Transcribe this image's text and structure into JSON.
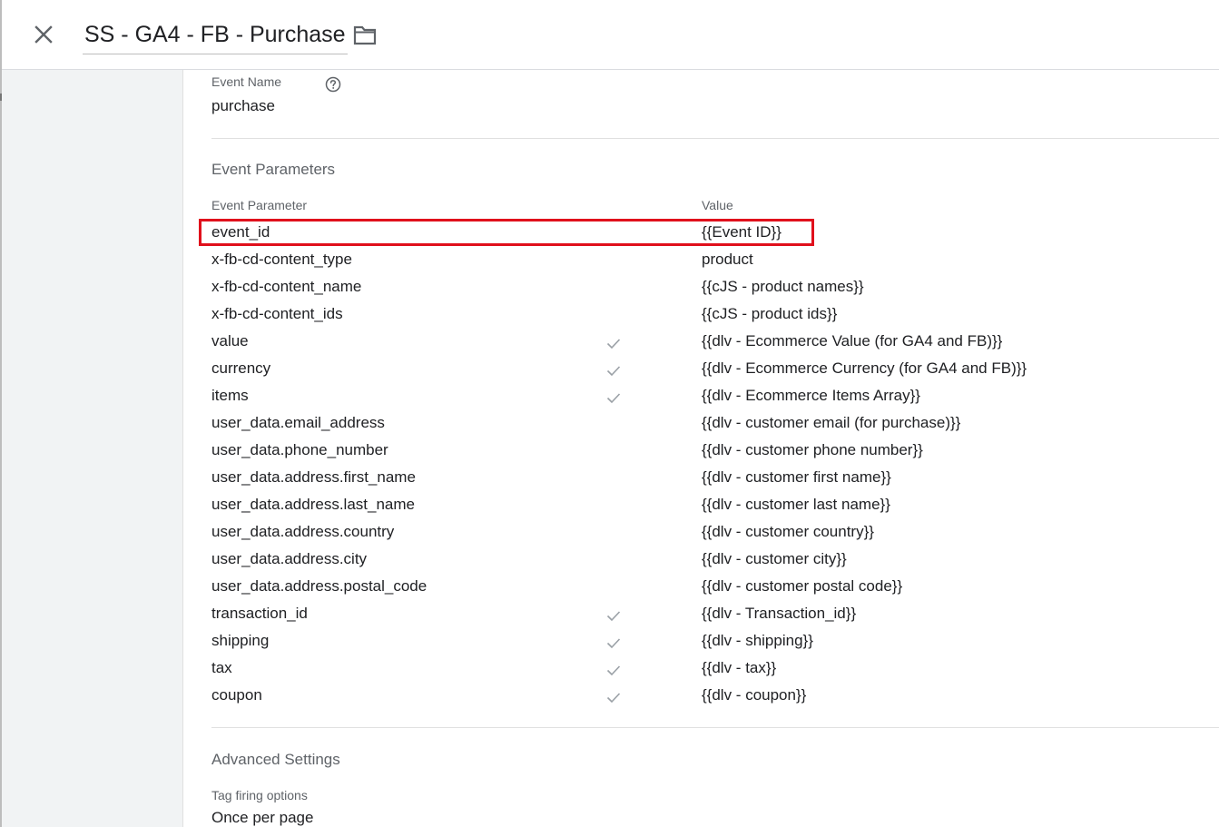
{
  "header": {
    "title": "SS - GA4 - FB - Purchase",
    "close_icon": "close-icon",
    "folder_icon": "folder-icon"
  },
  "event_name": {
    "label": "Event Name",
    "help_icon": "help-circle-icon",
    "value": "purchase"
  },
  "event_parameters": {
    "title": "Event Parameters",
    "col_param": "Event Parameter",
    "col_value": "Value",
    "highlight_color": "#e0101c",
    "rows": [
      {
        "param": "event_id",
        "value": "{{Event ID}}",
        "check": false,
        "highlighted": true
      },
      {
        "param": "x-fb-cd-content_type",
        "value": "product",
        "check": false
      },
      {
        "param": "x-fb-cd-content_name",
        "value": "{{cJS - product names}}",
        "check": false
      },
      {
        "param": "x-fb-cd-content_ids",
        "value": "{{cJS - product ids}}",
        "check": false
      },
      {
        "param": "value",
        "value": "{{dlv - Ecommerce Value (for GA4 and FB)}}",
        "check": true
      },
      {
        "param": "currency",
        "value": "{{dlv - Ecommerce Currency (for GA4 and FB)}}",
        "check": true
      },
      {
        "param": "items",
        "value": "{{dlv - Ecommerce Items Array}}",
        "check": true
      },
      {
        "param": "user_data.email_address",
        "value": "{{dlv - customer email (for purchase)}}",
        "check": false
      },
      {
        "param": "user_data.phone_number",
        "value": "{{dlv - customer phone number}}",
        "check": false
      },
      {
        "param": "user_data.address.first_name",
        "value": "{{dlv - customer first name}}",
        "check": false
      },
      {
        "param": "user_data.address.last_name",
        "value": "{{dlv - customer last name}}",
        "check": false
      },
      {
        "param": "user_data.address.country",
        "value": "{{dlv - customer country}}",
        "check": false
      },
      {
        "param": "user_data.address.city",
        "value": "{{dlv - customer city}}",
        "check": false
      },
      {
        "param": "user_data.address.postal_code",
        "value": "{{dlv - customer postal code}}",
        "check": false
      },
      {
        "param": "transaction_id",
        "value": "{{dlv - Transaction_id}}",
        "check": true
      },
      {
        "param": "shipping",
        "value": "{{dlv - shipping}}",
        "check": true
      },
      {
        "param": "tax",
        "value": "{{dlv - tax}}",
        "check": true
      },
      {
        "param": "coupon",
        "value": "{{dlv - coupon}}",
        "check": true
      }
    ]
  },
  "advanced_settings": {
    "title": "Advanced Settings",
    "firing_label": "Tag firing options",
    "firing_value": "Once per page"
  }
}
